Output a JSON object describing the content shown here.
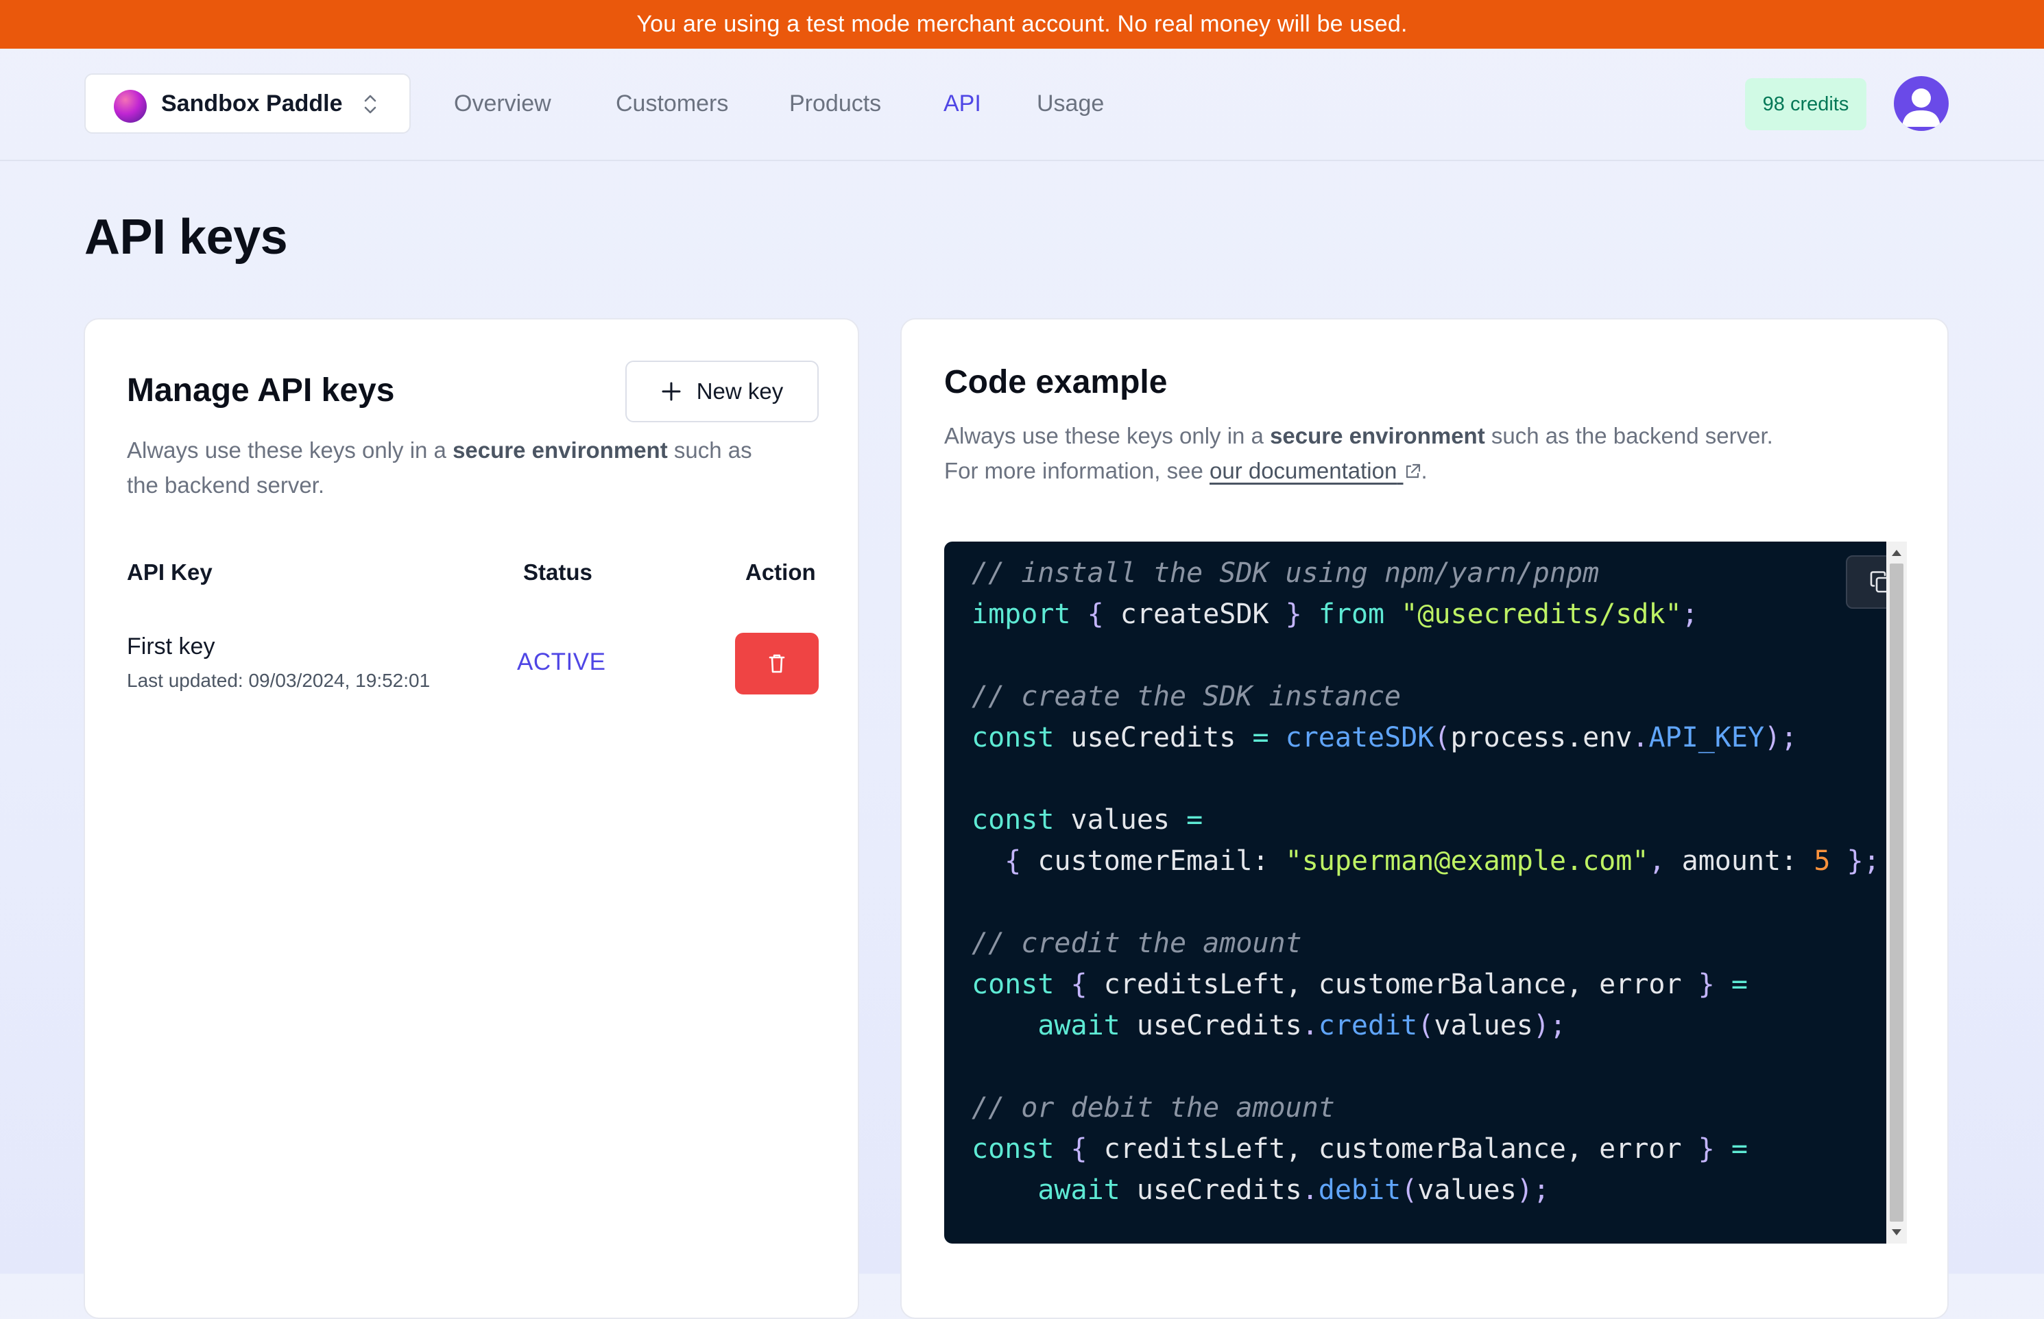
{
  "banner": {
    "text": "You are using a test mode merchant account. No real money will be used."
  },
  "header": {
    "merchant_name": "Sandbox Paddle",
    "nav": [
      {
        "label": "Overview"
      },
      {
        "label": "Customers"
      },
      {
        "label": "Products"
      },
      {
        "label": "API",
        "active": true
      },
      {
        "label": "Usage"
      }
    ],
    "credits": "98 credits",
    "colors": {
      "accent": "#4f46e5",
      "banner": "#ea580c",
      "credits_bg": "#d1fae5",
      "credits_text": "#047857"
    }
  },
  "page": {
    "title": "API keys"
  },
  "manage": {
    "title": "Manage API keys",
    "new_key_label": "New key",
    "desc_prefix": "Always use these keys only in a ",
    "desc_bold": "secure environment",
    "desc_suffix": " such as",
    "desc_line2": "the backend server.",
    "columns": {
      "key": "API Key",
      "status": "Status",
      "action": "Action"
    },
    "rows": [
      {
        "name": "First key",
        "updated": "Last updated: 09/03/2024, 19:52:01",
        "status": "ACTIVE"
      }
    ],
    "icons": {
      "add": "plus-icon",
      "delete": "trash-icon"
    },
    "delete_color": "#ef4444"
  },
  "code_example": {
    "title": "Code example",
    "desc_prefix": "Always use these keys only in a ",
    "desc_bold": "secure environment",
    "desc_suffix": " such as the backend server.",
    "info_prefix": "For more information, see ",
    "doc_link": "our documentation",
    "info_suffix": ".",
    "icons": {
      "external": "external-link-icon",
      "copy": "copy-icon"
    },
    "code": {
      "comment_install": "// install the SDK using npm/yarn/pnpm",
      "import_kw": "import",
      "import_fn": "createSDK",
      "from_kw": "from",
      "package": "\"@usecredits/sdk\"",
      "comment_create": "// create the SDK instance",
      "const_kw": "const",
      "var_usecredits": "useCredits",
      "create_call": "createSDK",
      "process_env": "process.env",
      "api_key": "API_KEY",
      "var_values": "values",
      "field_email": "customerEmail",
      "email_value": "\"superman@example.com\"",
      "field_amount": "amount",
      "amount_value": "5",
      "comment_credit": "// credit the amount",
      "destructure": "creditsLeft, customerBalance, error",
      "await_kw": "await",
      "credit_method": "credit",
      "comment_debit": "// or debit the amount",
      "debit_method": "debit"
    }
  }
}
